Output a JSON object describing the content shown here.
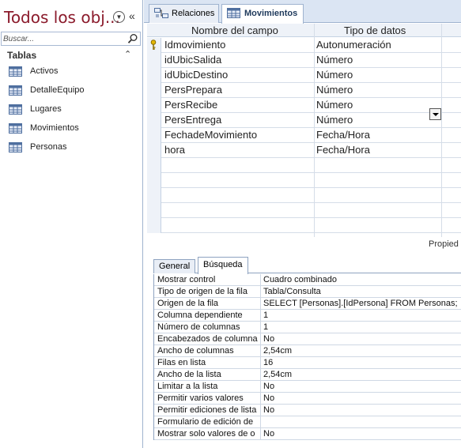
{
  "nav": {
    "title": "Todos los obj...",
    "search_placeholder": "Buscar...",
    "group_label": "Tablas",
    "items": [
      {
        "label": "Activos"
      },
      {
        "label": "DetalleEquipo"
      },
      {
        "label": "Lugares"
      },
      {
        "label": "Movimientos"
      },
      {
        "label": "Personas"
      }
    ]
  },
  "tabs": [
    {
      "label": "Relaciones",
      "icon": "relationships-icon"
    },
    {
      "label": "Movimientos",
      "icon": "table-icon"
    }
  ],
  "grid": {
    "col_name": "Nombre del campo",
    "col_type": "Tipo de datos",
    "rows": [
      {
        "name": "Idmovimiento",
        "type": "Autonumeración",
        "key": true
      },
      {
        "name": "idUbicSalida",
        "type": "Número"
      },
      {
        "name": "idUbicDestino",
        "type": "Número"
      },
      {
        "name": "PersPrepara",
        "type": "Número"
      },
      {
        "name": "PersRecibe",
        "type": "Número"
      },
      {
        "name": "PersEntrega",
        "type": "Número"
      },
      {
        "name": "FechadeMovimiento",
        "type": "Fecha/Hora"
      },
      {
        "name": "hora",
        "type": "Fecha/Hora"
      }
    ]
  },
  "properties_label": "Propied",
  "prop_tabs": [
    {
      "label": "General"
    },
    {
      "label": "Búsqueda"
    }
  ],
  "props": [
    {
      "name": "Mostrar control",
      "value": "Cuadro combinado"
    },
    {
      "name": "Tipo de origen de la fila",
      "value": "Tabla/Consulta"
    },
    {
      "name": "Origen de la fila",
      "value": "SELECT [Personas].[IdPersona] FROM Personas;"
    },
    {
      "name": "Columna dependiente",
      "value": "1"
    },
    {
      "name": "Número de columnas",
      "value": "1"
    },
    {
      "name": "Encabezados de columna",
      "value": "No"
    },
    {
      "name": "Ancho de columnas",
      "value": "2,54cm"
    },
    {
      "name": "Filas en lista",
      "value": "16"
    },
    {
      "name": "Ancho de la lista",
      "value": "2,54cm"
    },
    {
      "name": "Limitar a la lista",
      "value": "No"
    },
    {
      "name": "Permitir varios valores",
      "value": "No"
    },
    {
      "name": "Permitir ediciones de lista",
      "value": "No"
    },
    {
      "name": "Formulario de edición de",
      "value": ""
    },
    {
      "name": "Mostrar solo valores de o",
      "value": "No"
    }
  ],
  "colors": {
    "nav_title": "#8b1a2b",
    "accent": "#1e395b",
    "border": "#9fb3cf"
  }
}
